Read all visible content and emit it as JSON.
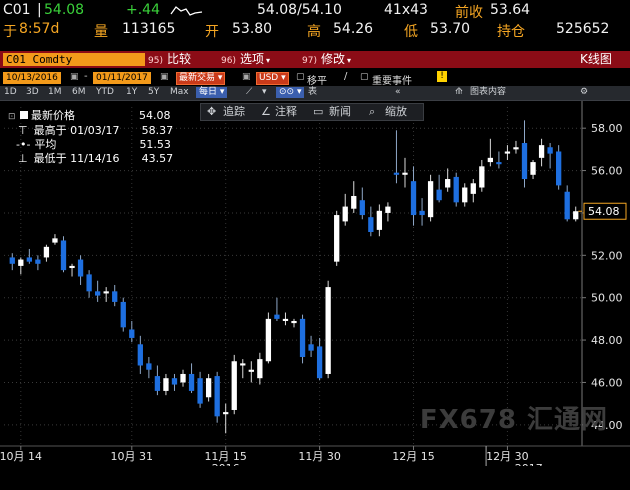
{
  "quote": {
    "ticker": "C01",
    "last": "54.08",
    "change": "+.44",
    "bidask": "54.08/54.10",
    "size": "41x43",
    "prev_close_label": "前收",
    "prev_close": "53.64",
    "time_prefix": "于",
    "time": "8:57d",
    "volume_label": "量",
    "volume": "113165",
    "open_label": "开",
    "open": "53.80",
    "high_label": "高",
    "high": "54.26",
    "low_label": "低",
    "low": "53.70",
    "oi_label": "持仓",
    "oi": "525652"
  },
  "toolbar1": {
    "security": "C01 Comdty",
    "btn1_num": "95)",
    "btn1": "比较",
    "btn2_num": "96)",
    "btn2": "选项",
    "btn3_num": "97)",
    "btn3": "修改",
    "right_label": "K线图"
  },
  "toolbar2": {
    "start_date": "10/13/2016",
    "end_date": "01/11/2017",
    "mode": "最新交易",
    "currency": "USD",
    "move": "移平",
    "events": "重要事件"
  },
  "toolbar3": {
    "periods": [
      "1D",
      "3D",
      "1M",
      "6M",
      "YTD",
      "1Y",
      "5Y",
      "Max"
    ],
    "frequency": "每日",
    "table_label": "表",
    "chart_content": "图表内容"
  },
  "toolbar4": {
    "track": "追踪",
    "annotate": "注释",
    "news": "新闻",
    "zoom": "缩放"
  },
  "legend": {
    "last_label": "最新价格",
    "last_value": "54.08",
    "high_label": "最高于 01/03/17",
    "high_value": "58.37",
    "avg_label": "平均",
    "avg_value": "51.53",
    "low_label": "最低于 11/14/16",
    "low_value": "43.57"
  },
  "watermark": "FX678 汇通网",
  "colors": {
    "up": "#ffffff",
    "down": "#1e6fe0",
    "last_box": "#f5a623",
    "ticker_bg": "#f39a1a",
    "toolbar_red": "#8b0c16"
  },
  "chart_data": {
    "type": "candlestick",
    "ylim": [
      43,
      59
    ],
    "yticks": [
      44,
      46,
      48,
      50,
      52,
      54,
      56,
      58
    ],
    "xticks": [
      "10月 14",
      "10月 31",
      "11月 15",
      "11月 30",
      "12月 15",
      "12月 30"
    ],
    "year_labels": [
      "2016",
      "2017"
    ],
    "last_value_label": "54.08",
    "candles": [
      {
        "o": 51.9,
        "h": 52.1,
        "l": 51.3,
        "c": 51.6
      },
      {
        "o": 51.5,
        "h": 51.9,
        "l": 51.1,
        "c": 51.8
      },
      {
        "o": 51.9,
        "h": 52.3,
        "l": 51.6,
        "c": 51.7
      },
      {
        "o": 51.8,
        "h": 52.0,
        "l": 51.3,
        "c": 51.6
      },
      {
        "o": 51.9,
        "h": 52.5,
        "l": 51.7,
        "c": 52.4
      },
      {
        "o": 52.6,
        "h": 53.0,
        "l": 52.5,
        "c": 52.8
      },
      {
        "o": 52.7,
        "h": 52.9,
        "l": 51.2,
        "c": 51.3
      },
      {
        "o": 51.4,
        "h": 51.6,
        "l": 51.0,
        "c": 51.5
      },
      {
        "o": 51.8,
        "h": 52.0,
        "l": 50.6,
        "c": 51.0
      },
      {
        "o": 51.1,
        "h": 51.3,
        "l": 50.0,
        "c": 50.3
      },
      {
        "o": 50.3,
        "h": 50.8,
        "l": 49.8,
        "c": 50.1
      },
      {
        "o": 50.2,
        "h": 50.5,
        "l": 49.8,
        "c": 50.3
      },
      {
        "o": 50.3,
        "h": 50.6,
        "l": 49.6,
        "c": 49.8
      },
      {
        "o": 49.8,
        "h": 50.0,
        "l": 48.4,
        "c": 48.6
      },
      {
        "o": 48.5,
        "h": 48.9,
        "l": 47.9,
        "c": 48.1
      },
      {
        "o": 47.8,
        "h": 48.2,
        "l": 46.4,
        "c": 46.8
      },
      {
        "o": 46.9,
        "h": 47.2,
        "l": 46.2,
        "c": 46.6
      },
      {
        "o": 46.3,
        "h": 46.8,
        "l": 45.4,
        "c": 45.6
      },
      {
        "o": 45.6,
        "h": 46.4,
        "l": 45.4,
        "c": 46.2
      },
      {
        "o": 46.2,
        "h": 46.4,
        "l": 45.6,
        "c": 45.9
      },
      {
        "o": 46.0,
        "h": 46.6,
        "l": 45.8,
        "c": 46.4
      },
      {
        "o": 46.4,
        "h": 46.9,
        "l": 45.5,
        "c": 45.6
      },
      {
        "o": 46.2,
        "h": 46.5,
        "l": 44.8,
        "c": 45.0
      },
      {
        "o": 45.3,
        "h": 46.4,
        "l": 45.1,
        "c": 46.2
      },
      {
        "o": 46.3,
        "h": 46.5,
        "l": 44.1,
        "c": 44.4
      },
      {
        "o": 44.5,
        "h": 45.0,
        "l": 43.6,
        "c": 44.6
      },
      {
        "o": 44.7,
        "h": 47.3,
        "l": 44.5,
        "c": 47.0
      },
      {
        "o": 46.8,
        "h": 47.1,
        "l": 46.2,
        "c": 46.9
      },
      {
        "o": 46.5,
        "h": 47.0,
        "l": 46.0,
        "c": 46.6
      },
      {
        "o": 46.2,
        "h": 47.4,
        "l": 45.9,
        "c": 47.1
      },
      {
        "o": 47.0,
        "h": 49.3,
        "l": 46.9,
        "c": 49.0
      },
      {
        "o": 49.2,
        "h": 50.0,
        "l": 48.9,
        "c": 49.0
      },
      {
        "o": 48.9,
        "h": 49.3,
        "l": 48.7,
        "c": 49.0
      },
      {
        "o": 48.8,
        "h": 49.0,
        "l": 48.6,
        "c": 48.9
      },
      {
        "o": 49.0,
        "h": 49.2,
        "l": 46.9,
        "c": 47.2
      },
      {
        "o": 47.8,
        "h": 48.2,
        "l": 47.2,
        "c": 47.5
      },
      {
        "o": 47.7,
        "h": 48.1,
        "l": 46.1,
        "c": 46.2
      },
      {
        "o": 46.4,
        "h": 50.8,
        "l": 46.2,
        "c": 50.5
      },
      {
        "o": 51.7,
        "h": 54.1,
        "l": 51.5,
        "c": 53.9
      },
      {
        "o": 53.6,
        "h": 54.9,
        "l": 53.4,
        "c": 54.3
      },
      {
        "o": 54.2,
        "h": 55.5,
        "l": 54.0,
        "c": 54.8
      },
      {
        "o": 54.6,
        "h": 55.2,
        "l": 53.7,
        "c": 53.9
      },
      {
        "o": 53.8,
        "h": 54.3,
        "l": 52.9,
        "c": 53.1
      },
      {
        "o": 53.2,
        "h": 54.4,
        "l": 52.9,
        "c": 54.1
      },
      {
        "o": 54.0,
        "h": 54.5,
        "l": 53.6,
        "c": 54.3
      },
      {
        "o": 55.9,
        "h": 57.9,
        "l": 55.4,
        "c": 55.8
      },
      {
        "o": 55.8,
        "h": 56.6,
        "l": 55.2,
        "c": 55.9
      },
      {
        "o": 55.5,
        "h": 56.2,
        "l": 53.4,
        "c": 53.9
      },
      {
        "o": 54.1,
        "h": 54.7,
        "l": 53.4,
        "c": 53.9
      },
      {
        "o": 53.8,
        "h": 55.8,
        "l": 53.6,
        "c": 55.5
      },
      {
        "o": 55.1,
        "h": 55.8,
        "l": 54.5,
        "c": 54.6
      },
      {
        "o": 55.2,
        "h": 56.1,
        "l": 55.0,
        "c": 55.6
      },
      {
        "o": 55.7,
        "h": 55.9,
        "l": 54.3,
        "c": 54.5
      },
      {
        "o": 54.5,
        "h": 55.4,
        "l": 54.3,
        "c": 55.2
      },
      {
        "o": 54.9,
        "h": 55.6,
        "l": 54.5,
        "c": 55.4
      },
      {
        "o": 55.2,
        "h": 56.5,
        "l": 55.0,
        "c": 56.2
      },
      {
        "o": 56.4,
        "h": 57.5,
        "l": 56.2,
        "c": 56.6
      },
      {
        "o": 56.4,
        "h": 56.9,
        "l": 56.1,
        "c": 56.3
      },
      {
        "o": 56.8,
        "h": 57.2,
        "l": 56.5,
        "c": 56.9
      },
      {
        "o": 57.0,
        "h": 57.4,
        "l": 56.8,
        "c": 57.1
      },
      {
        "o": 57.3,
        "h": 58.37,
        "l": 55.2,
        "c": 55.6
      },
      {
        "o": 55.8,
        "h": 56.5,
        "l": 55.6,
        "c": 56.4
      },
      {
        "o": 56.6,
        "h": 57.5,
        "l": 56.2,
        "c": 57.2
      },
      {
        "o": 57.1,
        "h": 57.3,
        "l": 56.1,
        "c": 56.8
      },
      {
        "o": 56.9,
        "h": 57.2,
        "l": 55.1,
        "c": 55.3
      },
      {
        "o": 55.0,
        "h": 55.3,
        "l": 53.6,
        "c": 53.7
      },
      {
        "o": 53.7,
        "h": 54.3,
        "l": 53.6,
        "c": 54.08
      }
    ]
  }
}
